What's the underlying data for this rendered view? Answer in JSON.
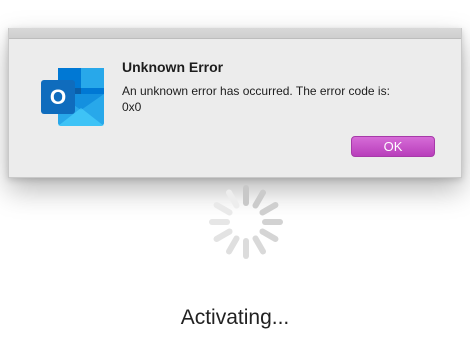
{
  "dialog": {
    "title": "Unknown Error",
    "message": "An unknown error has occurred. The error code is: 0x0",
    "ok_label": "OK",
    "ok_color": "#c24fc4"
  },
  "app": {
    "icon": "outlook-icon",
    "icon_letter": "O",
    "brand_colors": [
      "#0364b8",
      "#0078d4",
      "#28a8ea",
      "#50d9ff"
    ]
  },
  "status": {
    "text": "Activating...",
    "spinner_icon": "spinner-icon"
  }
}
